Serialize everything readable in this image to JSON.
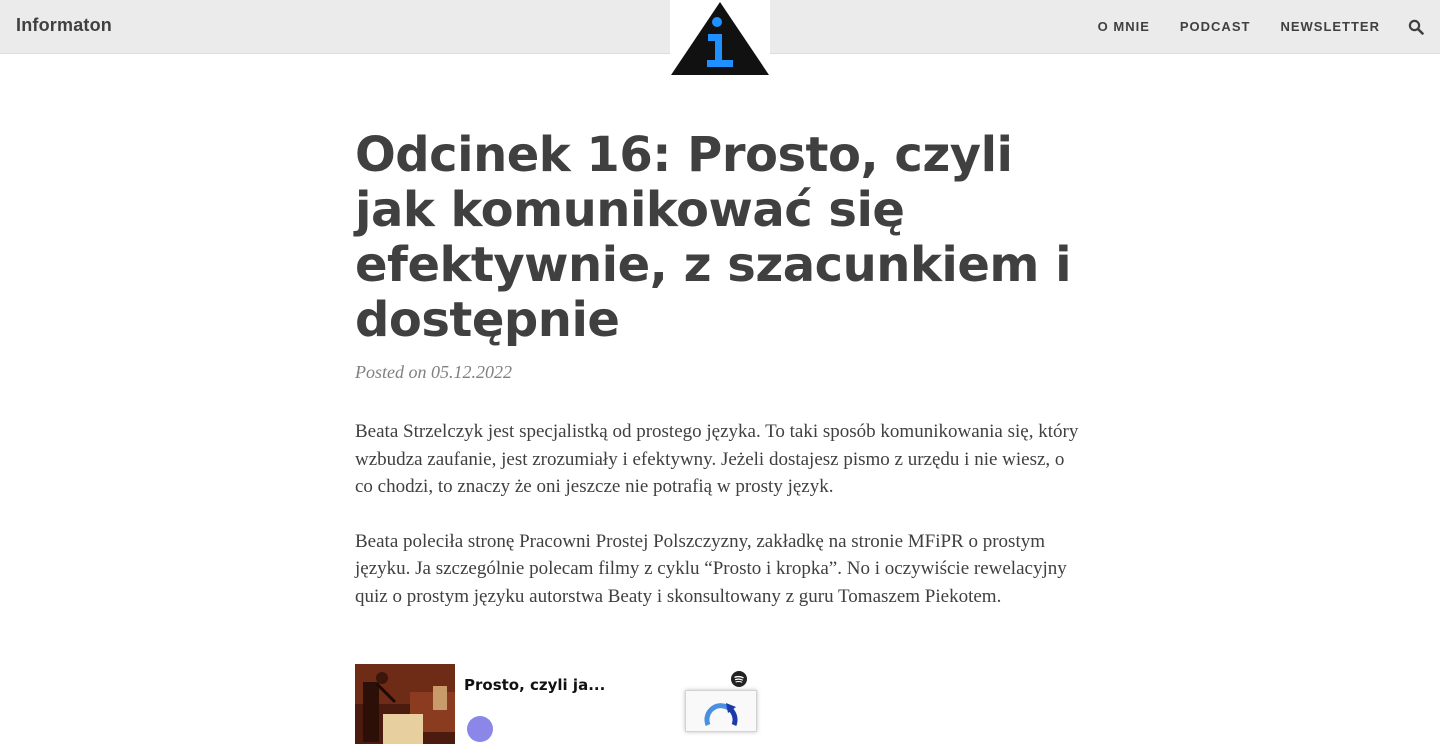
{
  "site": {
    "brand": "Informaton"
  },
  "nav": {
    "items": [
      {
        "label": "O MNIE"
      },
      {
        "label": "PODCAST"
      },
      {
        "label": "NEWSLETTER"
      }
    ],
    "search_icon": "search-icon"
  },
  "logo": {
    "icon": "info-triangle-logo",
    "colors": {
      "triangle": "#111111",
      "glyph": "#1e90ff"
    }
  },
  "post": {
    "title": "Odcinek 16: Prosto, czyli jak komunikować się efektywnie, z szacunkiem i dostępnie",
    "posted_label": "Posted on",
    "date": "05.12.2022",
    "paragraphs": [
      "Beata Strzelczyk jest specjalistką od prostego języka. To taki sposób komunikowania się, który wzbudza zaufanie, jest zrozumiały i efektywny. Jeżeli dostajesz pismo z urzędu i nie wiesz, o co chodzi, to znaczy że oni jeszcze nie potrafią w prosty język.",
      "Beata poleciła stronę Pracowni Prostej Polszczyzny, zakładkę na stronie MFiPR o prostym języku. Ja szczególnie polecam filmy z cyklu “Prosto i kropka”. No i oczywiście rewelacyjny quiz o prostym języku autorstwa Beaty i skonsultowany z guru Tomaszem Piekotem."
    ]
  },
  "embed": {
    "title": "Prosto, czyli ja...",
    "icon": "spotify-icon"
  },
  "recaptcha": {
    "icon": "recaptcha-icon"
  }
}
